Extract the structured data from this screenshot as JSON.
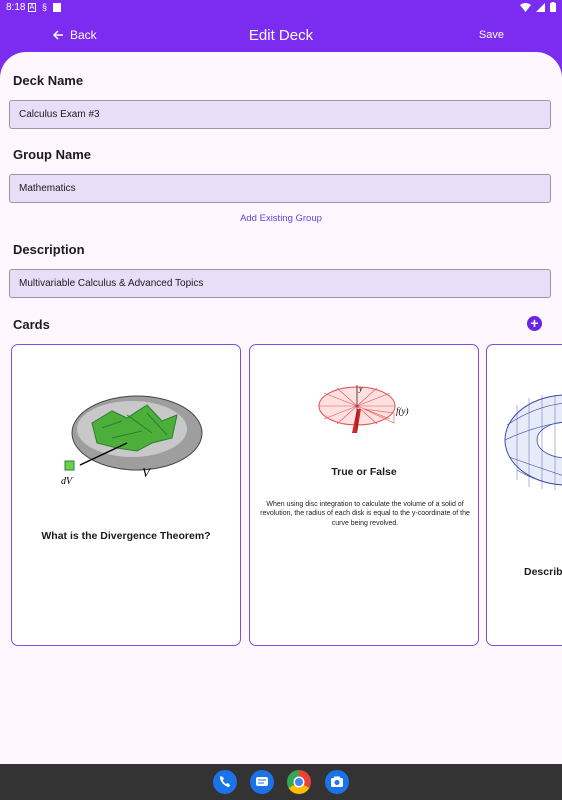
{
  "status_bar": {
    "time": "8:18"
  },
  "app_bar": {
    "back_label": "Back",
    "title": "Edit Deck",
    "save_label": "Save"
  },
  "form": {
    "deck_name_label": "Deck Name",
    "deck_name_value": "Calculus Exam #3",
    "group_name_label": "Group Name",
    "group_name_value": "Mathematics",
    "add_existing_group": "Add Existing Group",
    "description_label": "Description",
    "description_value": "Multivariable Calculus & Advanced Topics"
  },
  "cards_section": {
    "label": "Cards",
    "cards": [
      {
        "title": "What is the Divergence Theorem?",
        "body": "",
        "image": "divergence-figure",
        "fig_labels": [
          "V",
          "dV"
        ]
      },
      {
        "title": "True or False",
        "body": "When using disc integration to calculate the volume of a solid of revolution, the radius of each disk is equal to the y-coordinate of the curve being revolved.",
        "image": "disc-integration-figure",
        "fig_labels": [
          "y",
          "f(y)"
        ]
      },
      {
        "title": "Describ",
        "body": "",
        "image": "torus-figure"
      }
    ]
  },
  "nav_bar": {
    "apps": [
      "phone-icon",
      "messages-icon",
      "chrome-icon",
      "camera-icon"
    ]
  },
  "colors": {
    "primary": "#7b2cf0",
    "field_bg": "#e8def8",
    "link": "#6b3fe0",
    "card_border": "#7b51df"
  }
}
